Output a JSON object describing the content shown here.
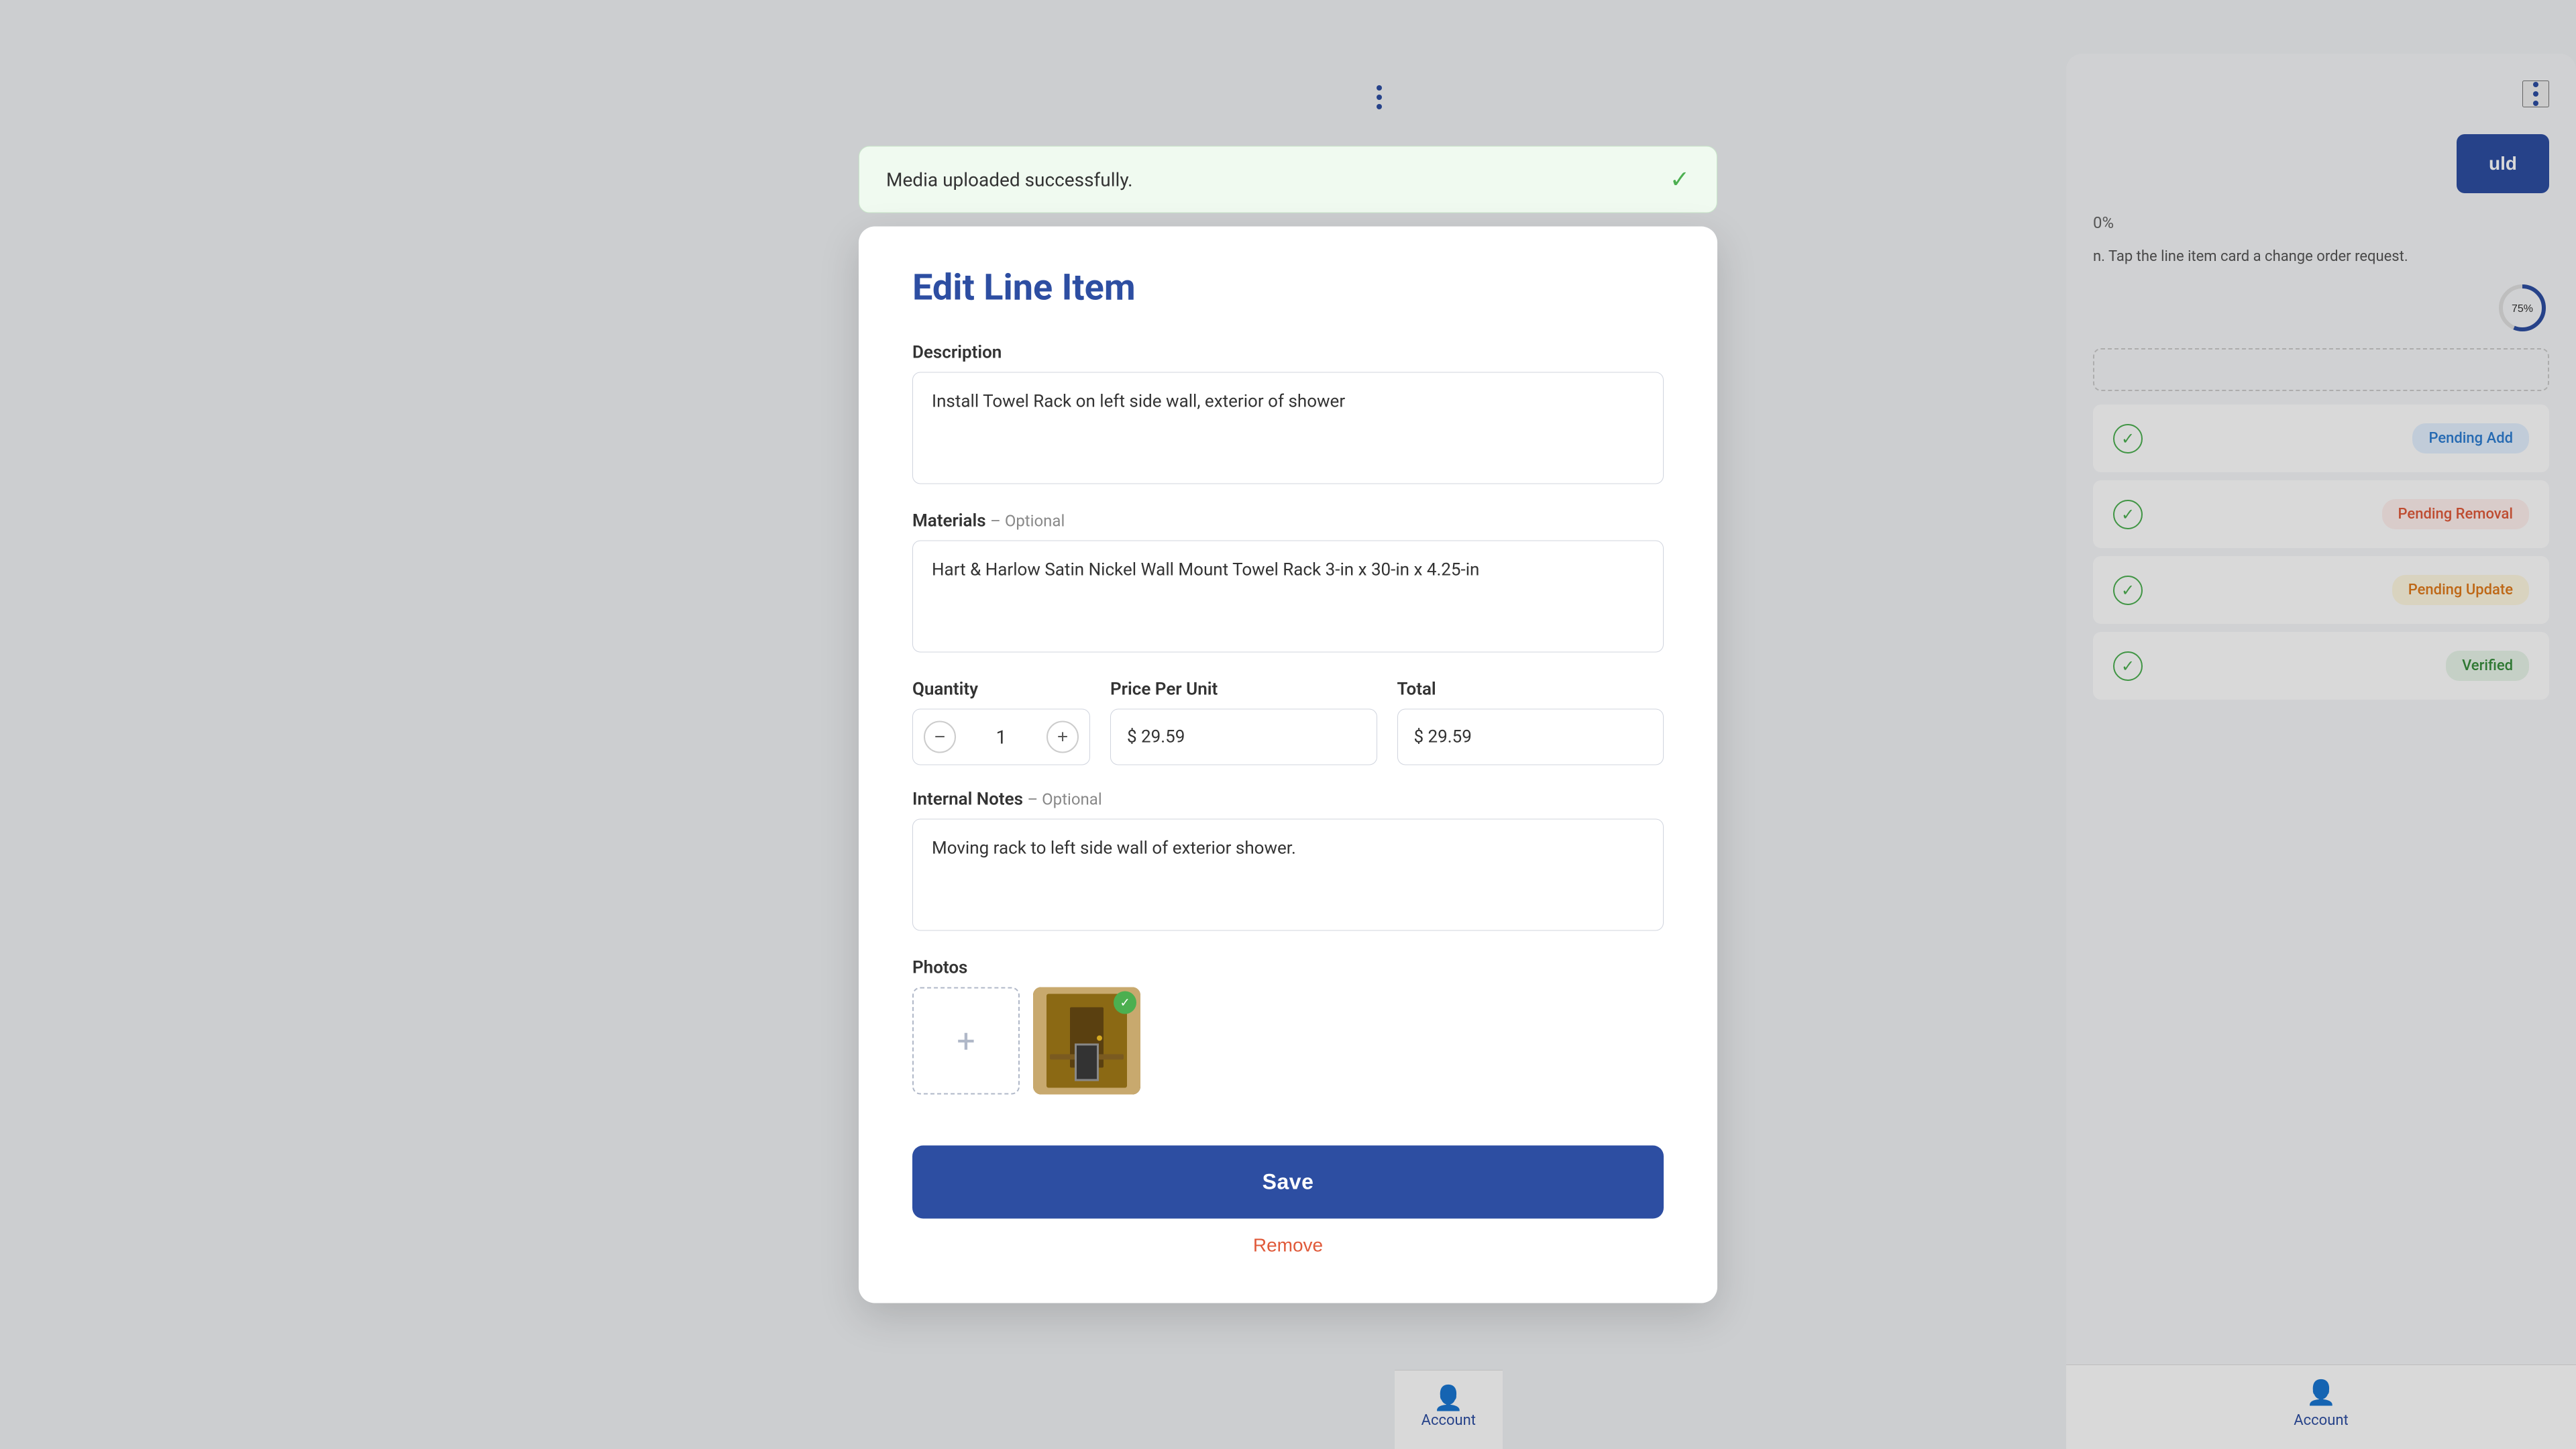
{
  "notification": {
    "message": "Media uploaded successfully.",
    "success_icon": "✓"
  },
  "modal": {
    "title": "Edit Line Item",
    "description_label": "Description",
    "description_value": "Install Towel Rack on left side wall, exterior of shower",
    "materials_label": "Materials",
    "materials_optional": "– Optional",
    "materials_value": "Hart & Harlow Satin Nickel Wall Mount Towel Rack 3-in x 30-in x 4.25-in",
    "quantity_label": "Quantity",
    "quantity_value": "1",
    "price_per_unit_label": "Price Per Unit",
    "price_per_unit_value": "$ 29.59",
    "total_label": "Total",
    "total_value": "$ 29.59",
    "internal_notes_label": "Internal Notes",
    "internal_notes_optional": "– Optional",
    "internal_notes_value": "Moving rack to left side wall of exterior shower.",
    "photos_label": "Photos",
    "save_label": "Save",
    "remove_label": "Remove"
  },
  "right_panel": {
    "three_dots_icon": "⋮",
    "upload_label": "uld",
    "progress_percent": "0%",
    "hint_text": "n. Tap the line item card\na change order request.",
    "circular_value": "75%"
  },
  "line_items": [
    {
      "status": "Pending Add",
      "status_type": "pending-add"
    },
    {
      "status": "Pending Removal",
      "status_type": "pending-removal"
    },
    {
      "status": "Pending Update",
      "status_type": "pending-update"
    },
    {
      "status": "Verified",
      "status_type": "verified"
    }
  ],
  "bottom_nav": [
    {
      "label": "Account",
      "icon": "👤",
      "id": "account-1"
    },
    {
      "label": "Account",
      "icon": "👤",
      "id": "account-2"
    }
  ],
  "icons": {
    "check": "✓",
    "plus": "+",
    "minus": "−",
    "three_dots": "⋮"
  }
}
